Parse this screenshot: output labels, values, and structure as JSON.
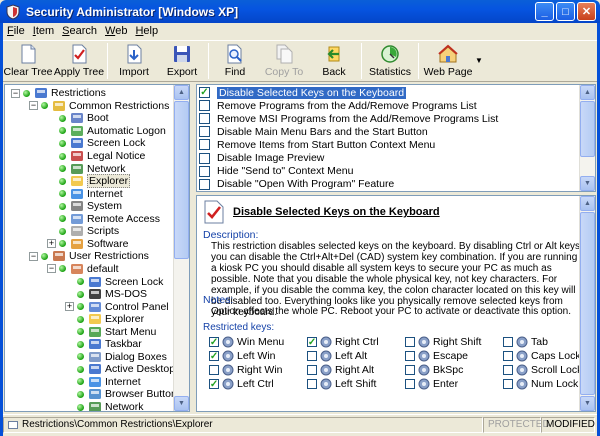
{
  "window": {
    "title": "Security Administrator [Windows XP]",
    "minimize": "_",
    "maximize": "□",
    "close": "✕"
  },
  "menu": [
    {
      "pre": "",
      "key": "F",
      "rest": "ile"
    },
    {
      "pre": "",
      "key": "I",
      "rest": "tem"
    },
    {
      "pre": "",
      "key": "S",
      "rest": "earch"
    },
    {
      "pre": "",
      "key": "W",
      "rest": "eb"
    },
    {
      "pre": "",
      "key": "H",
      "rest": "elp"
    }
  ],
  "toolbar": {
    "clear_tree": "Clear Tree",
    "apply_tree": "Apply Tree",
    "import": "Import",
    "export": "Export",
    "find": "Find",
    "copy_to": "Copy To",
    "back": "Back",
    "statistics": "Statistics",
    "web_page": "Web Page"
  },
  "tree": [
    {
      "label": "Restrictions",
      "level": 0,
      "expander": "−",
      "icon": "restrictions-icon"
    },
    {
      "label": "Common Restrictions",
      "level": 1,
      "expander": "−",
      "icon": "key-icon"
    },
    {
      "label": "Boot",
      "level": 2,
      "icon": "boot-icon"
    },
    {
      "label": "Automatic Logon",
      "level": 2,
      "icon": "logon-icon"
    },
    {
      "label": "Screen Lock",
      "level": 2,
      "icon": "screen-lock-icon"
    },
    {
      "label": "Legal Notice",
      "level": 2,
      "icon": "legal-notice-icon"
    },
    {
      "label": "Network",
      "level": 2,
      "icon": "network-icon"
    },
    {
      "label": "Explorer",
      "level": 2,
      "icon": "folder-icon",
      "selected": true
    },
    {
      "label": "Internet",
      "level": 2,
      "icon": "internet-icon"
    },
    {
      "label": "System",
      "level": 2,
      "icon": "system-icon"
    },
    {
      "label": "Remote Access",
      "level": 2,
      "icon": "remote-access-icon"
    },
    {
      "label": "Scripts",
      "level": 2,
      "icon": "scripts-icon"
    },
    {
      "label": "Software",
      "level": 2,
      "expander": "+",
      "icon": "software-icon"
    },
    {
      "label": "User Restrictions",
      "level": 1,
      "expander": "−",
      "icon": "users-icon"
    },
    {
      "label": "default",
      "level": 2,
      "expander": "−",
      "icon": "user-icon"
    },
    {
      "label": "Screen Lock",
      "level": 3,
      "icon": "screen-lock-icon"
    },
    {
      "label": "MS-DOS",
      "level": 3,
      "icon": "msdos-icon"
    },
    {
      "label": "Control Panel",
      "level": 3,
      "expander": "+",
      "icon": "control-panel-icon"
    },
    {
      "label": "Explorer",
      "level": 3,
      "icon": "folder-icon"
    },
    {
      "label": "Start Menu",
      "level": 3,
      "icon": "start-menu-icon"
    },
    {
      "label": "Taskbar",
      "level": 3,
      "icon": "taskbar-icon"
    },
    {
      "label": "Dialog Boxes",
      "level": 3,
      "icon": "dialog-boxes-icon"
    },
    {
      "label": "Active Desktop",
      "level": 3,
      "icon": "active-desktop-icon"
    },
    {
      "label": "Internet",
      "level": 3,
      "icon": "internet-icon"
    },
    {
      "label": "Browser Buttons",
      "level": 3,
      "icon": "browser-buttons-icon"
    },
    {
      "label": "Network",
      "level": 3,
      "icon": "network-icon"
    }
  ],
  "list": [
    {
      "label": "Disable Selected Keys on the Keyboard",
      "checked": true,
      "selected": true
    },
    {
      "label": "Remove Programs from the Add/Remove Programs List",
      "checked": false
    },
    {
      "label": "Remove MSI Programs from the Add/Remove Programs List",
      "checked": false
    },
    {
      "label": "Disable Main Menu Bars and the Start Button",
      "checked": false
    },
    {
      "label": "Remove Items from Start Button Context Menu",
      "checked": false
    },
    {
      "label": "Disable Image Preview",
      "checked": false
    },
    {
      "label": "Hide \"Send to\" Context Menu",
      "checked": false
    },
    {
      "label": "Disable \"Open With Program\" Feature",
      "checked": false
    }
  ],
  "detail": {
    "title": "Disable Selected Keys on the Keyboard",
    "description_label": "Description:",
    "description": "This restriction disables selected keys on the keyboard. By disabling Ctrl or Alt keys you can disable the Ctrl+Alt+Del (CAD) system key combination. If you are running a kiosk PC you should disable all system keys to secure your PC as much as possible. Note that you disable the whole physical key, not key characters. For example, if you disable the comma key, the colon character located on this key will be disabled too. Everything looks like you physically remove selected keys from your keyboard.",
    "notes_label": "Notes:",
    "notes": "Option affects the whole PC. Reboot your PC to activate or deactivate this option.",
    "restricted_label": "Restricted keys:",
    "keys": [
      {
        "label": "Win Menu",
        "checked": true
      },
      {
        "label": "Right Ctrl",
        "checked": true
      },
      {
        "label": "Right Shift",
        "checked": false
      },
      {
        "label": "Tab",
        "checked": false
      },
      {
        "label": "Left Win",
        "checked": true
      },
      {
        "label": "Left Alt",
        "checked": false
      },
      {
        "label": "Escape",
        "checked": false
      },
      {
        "label": "Caps Lock",
        "checked": false
      },
      {
        "label": "Right Win",
        "checked": false
      },
      {
        "label": "Right Alt",
        "checked": false
      },
      {
        "label": "BkSpc",
        "checked": false
      },
      {
        "label": "Scroll Lock",
        "checked": false
      },
      {
        "label": "Left Ctrl",
        "checked": true
      },
      {
        "label": "Left Shift",
        "checked": false
      },
      {
        "label": "Enter",
        "checked": false
      },
      {
        "label": "Num Lock",
        "checked": false
      }
    ]
  },
  "status": {
    "path": "Restrictions\\Common Restrictions\\Explorer",
    "protected": "PROTECTED",
    "modified": "MODIFIED"
  }
}
